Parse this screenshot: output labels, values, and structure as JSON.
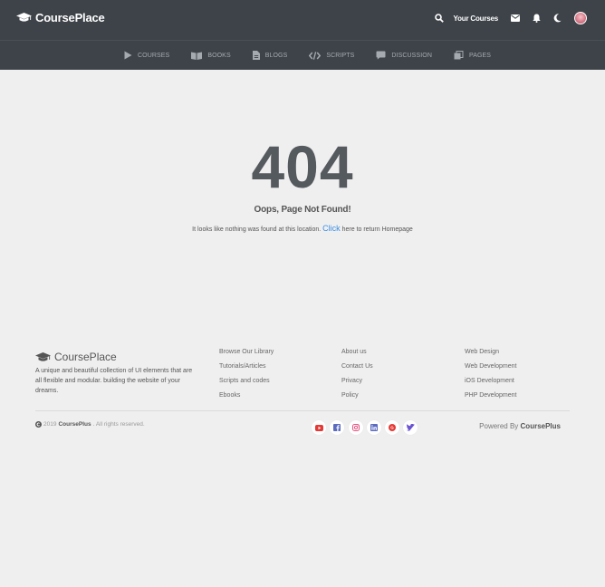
{
  "header": {
    "brand": "CoursePlace",
    "your_courses": "Your Courses",
    "icons": [
      "search-icon",
      "envelope-icon",
      "bell-icon",
      "moon-icon",
      "avatar"
    ]
  },
  "nav": {
    "items": [
      {
        "label": "COURSES",
        "icon": "play-icon"
      },
      {
        "label": "BOOKS",
        "icon": "book-icon"
      },
      {
        "label": "BLOGS",
        "icon": "file-icon"
      },
      {
        "label": "SCRIPTS",
        "icon": "code-icon"
      },
      {
        "label": "DISCUSSION",
        "icon": "comment-icon"
      },
      {
        "label": "PAGES",
        "icon": "copy-icon"
      }
    ]
  },
  "error": {
    "code": "404",
    "title": "Oops, Page Not Found!",
    "message_before": "It looks like nothing was found at this location.",
    "link": "Click",
    "message_after": "here to return Homepage"
  },
  "footer": {
    "brand": "CoursePlace",
    "description": "A unique and beautiful collection of UI elements that are all flexible and modular. building the website of your dreams.",
    "col1": [
      "Browse Our Library",
      "Tutorials/Articles",
      "Scripts and codes",
      "Ebooks"
    ],
    "col2": [
      "About us",
      "Contact Us",
      "Privacy",
      "Policy"
    ],
    "col3": [
      "Web Design",
      "Web Development",
      "iOS Development",
      "PHP Development"
    ],
    "copyright_year": "2019",
    "copyright_owner": "CoursePlus",
    "copyright_rest": ". All rights reserved.",
    "powered_by": "Powered By",
    "powered_brand": "CoursePlus",
    "socials": [
      {
        "name": "youtube-icon",
        "color": "#e53935"
      },
      {
        "name": "facebook-icon",
        "color": "#5b6bc0"
      },
      {
        "name": "instagram-icon",
        "color": "#e75480"
      },
      {
        "name": "linkedin-icon",
        "color": "#5b6bc0"
      },
      {
        "name": "google-plus-icon",
        "color": "#e53935"
      },
      {
        "name": "twitter-icon",
        "color": "#6a52d0"
      }
    ]
  },
  "colors": {
    "header_bg": "#3e4349",
    "page_bg": "#efefef",
    "link": "#3a8ee6"
  }
}
